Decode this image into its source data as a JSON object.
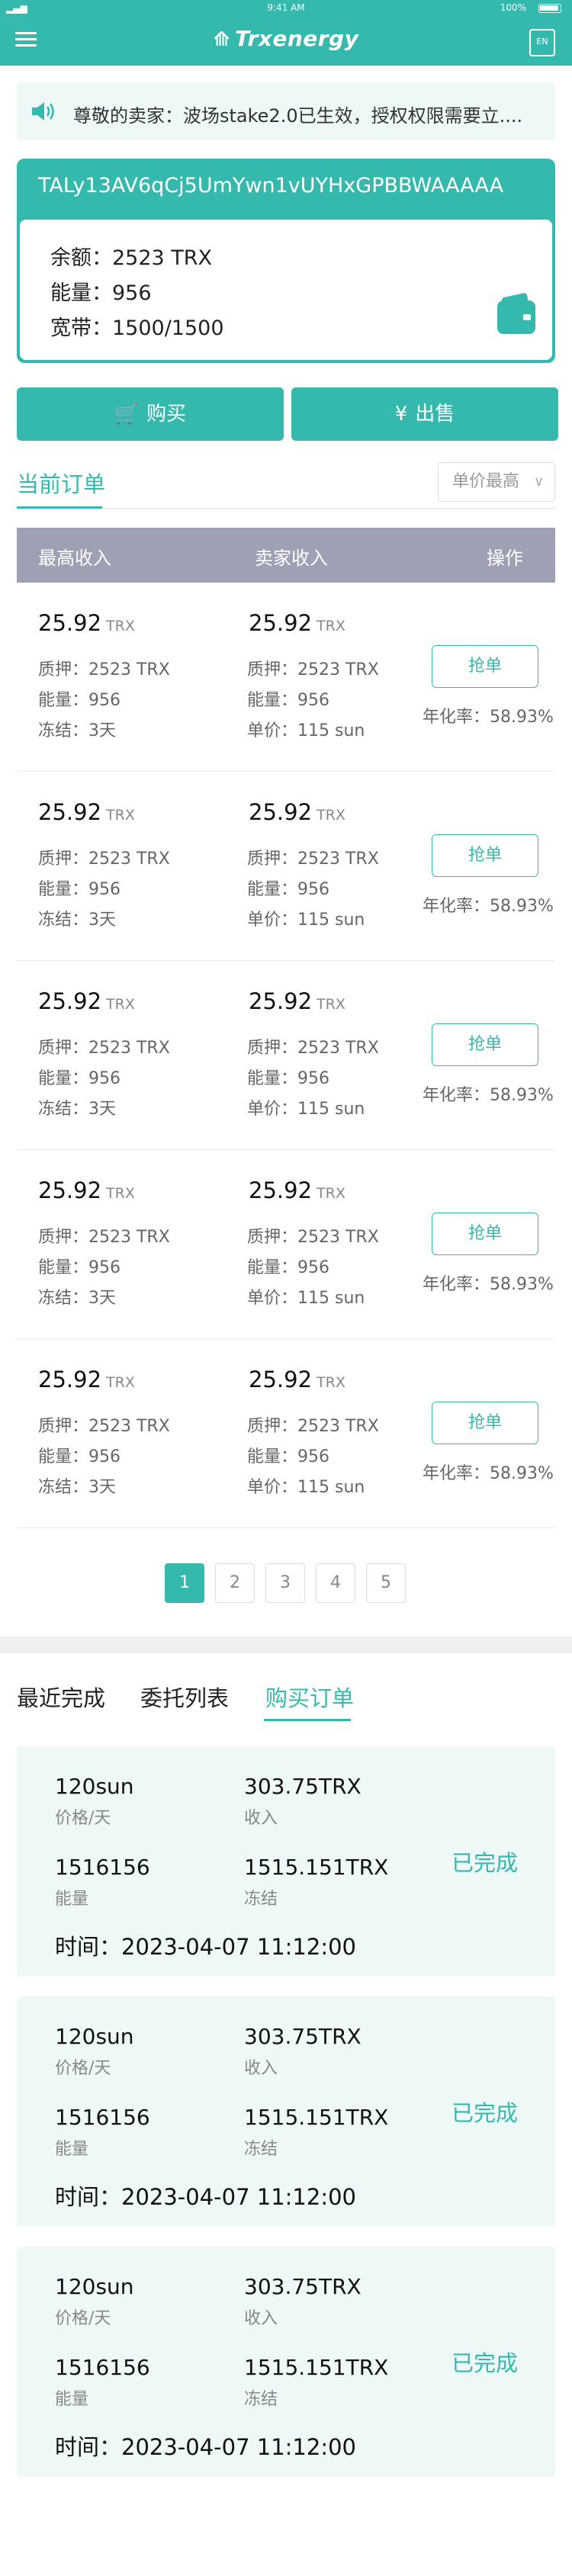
{
  "status_bar": {
    "time": "9:41 AM",
    "battery": "100%"
  },
  "header": {
    "brand": "Trxenergy",
    "lang_icon": "language-icon"
  },
  "notice": {
    "text": "尊敬的卖家：波场stake2.0已生效，授权权限需要立...."
  },
  "account": {
    "address": "TALy13AV6qCj5UmYwn1vUYHxGPBBWAAAAA",
    "balance": "余额：2523 TRX",
    "energy": "能量：956",
    "bandwidth": "宽带：1500/1500"
  },
  "actions": {
    "buy": "购买",
    "sell": "出售"
  },
  "orders_tab": {
    "label": "当前订单",
    "sort": "单价最高"
  },
  "table": {
    "headers": [
      "最高收入",
      "卖家收入",
      "操作"
    ],
    "rows": [
      {
        "income_max": "25.92",
        "income_seller": "25.92",
        "unit": "TRX",
        "pledge1": "质押：2523 TRX",
        "energy1": "能量：956",
        "freeze": "冻结：3天",
        "pledge2": "质押：2523 TRX",
        "energy2": "能量：956",
        "price": "单价：115 sun",
        "grab": "抢单",
        "rate": "年化率：58.93%"
      },
      {
        "income_max": "25.92",
        "income_seller": "25.92",
        "unit": "TRX",
        "pledge1": "质押：2523 TRX",
        "energy1": "能量：956",
        "freeze": "冻结：3天",
        "pledge2": "质押：2523 TRX",
        "energy2": "能量：956",
        "price": "单价：115 sun",
        "grab": "抢单",
        "rate": "年化率：58.93%"
      },
      {
        "income_max": "25.92",
        "income_seller": "25.92",
        "unit": "TRX",
        "pledge1": "质押：2523 TRX",
        "energy1": "能量：956",
        "freeze": "冻结：3天",
        "pledge2": "质押：2523 TRX",
        "energy2": "能量：956",
        "price": "单价：115 sun",
        "grab": "抢单",
        "rate": "年化率：58.93%"
      },
      {
        "income_max": "25.92",
        "income_seller": "25.92",
        "unit": "TRX",
        "pledge1": "质押：2523 TRX",
        "energy1": "能量：956",
        "freeze": "冻结：3天",
        "pledge2": "质押：2523 TRX",
        "energy2": "能量：956",
        "price": "单价：115 sun",
        "grab": "抢单",
        "rate": "年化率：58.93%"
      },
      {
        "income_max": "25.92",
        "income_seller": "25.92",
        "unit": "TRX",
        "pledge1": "质押：2523 TRX",
        "energy1": "能量：956",
        "freeze": "冻结：3天",
        "pledge2": "质押：2523 TRX",
        "energy2": "能量：956",
        "price": "单价：115 sun",
        "grab": "抢单",
        "rate": "年化率：58.93%"
      }
    ]
  },
  "pagination": {
    "pages": [
      "1",
      "2",
      "3",
      "4",
      "5"
    ],
    "current": "1"
  },
  "history_tabs": [
    "最近完成",
    "委托列表",
    "购买订单"
  ],
  "history": [
    {
      "price": "120sun",
      "price_label": "价格/天",
      "income": "303.75TRX",
      "income_label": "收入",
      "energy": "1516156",
      "energy_label": "能量",
      "freeze": "1515.151TRX",
      "freeze_label": "冻结",
      "status": "已完成",
      "time": "时间：2023-04-07 11:12:00"
    },
    {
      "price": "120sun",
      "price_label": "价格/天",
      "income": "303.75TRX",
      "income_label": "收入",
      "energy": "1516156",
      "energy_label": "能量",
      "freeze": "1515.151TRX",
      "freeze_label": "冻结",
      "status": "已完成",
      "time": "时间：2023-04-07 11:12:00"
    },
    {
      "price": "120sun",
      "price_label": "价格/天",
      "income": "303.75TRX",
      "income_label": "收入",
      "energy": "1516156",
      "energy_label": "能量",
      "freeze": "1515.151TRX",
      "freeze_label": "冻结",
      "status": "已完成",
      "time": "时间：2023-04-07 11:12:00"
    }
  ],
  "colors": {
    "accent": "#35b9ad",
    "table_header": "#9ea1b3",
    "card_bg": "#eef8f7"
  }
}
